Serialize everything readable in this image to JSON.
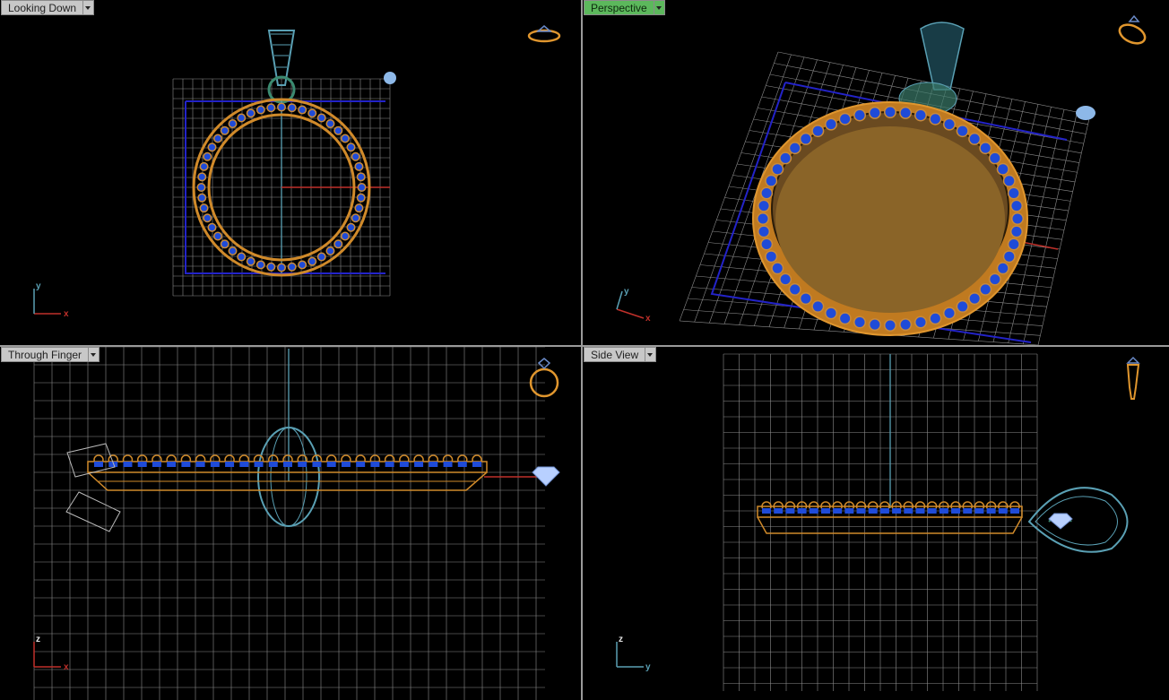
{
  "viewports": [
    {
      "id": "top-left",
      "label": "Looking Down",
      "active": false,
      "axes": {
        "h": "x",
        "v": "y"
      }
    },
    {
      "id": "top-right",
      "label": "Perspective",
      "active": true,
      "axes": {
        "h": "x",
        "v": "y"
      }
    },
    {
      "id": "bottom-left",
      "label": "Through Finger",
      "active": false,
      "axes": {
        "h": "x",
        "v": "z"
      }
    },
    {
      "id": "bottom-right",
      "label": "Side View",
      "active": false,
      "axes": {
        "h": "y",
        "v": "z"
      }
    }
  ],
  "colors": {
    "background": "#000000",
    "grid": "#8c8c8c",
    "gold": "#d08a2a",
    "gem": "#1f4bd8",
    "bail": "#5aa0b4",
    "axis_x": "#c0302a",
    "axis_y": "#5aa0b4",
    "construction_plane": "#2020c0"
  },
  "icons": [
    "ring-orientation-icon",
    "dropdown-arrow-icon"
  ]
}
